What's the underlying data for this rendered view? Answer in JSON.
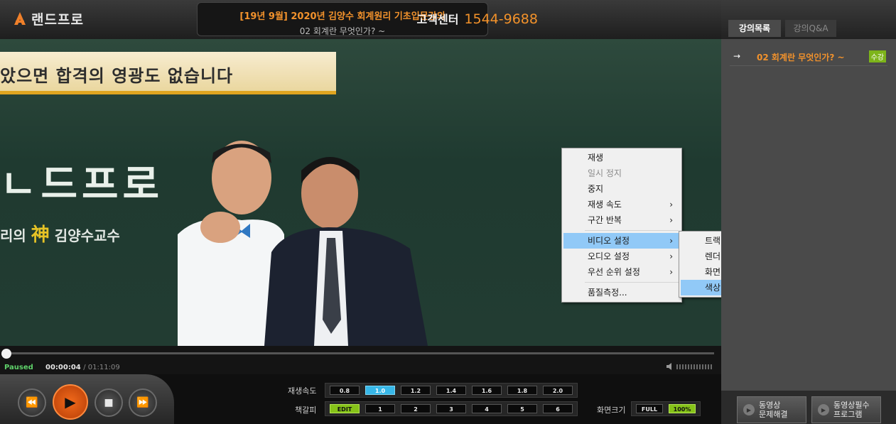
{
  "header": {
    "logo_text": "랜드프로",
    "lecture_title": "[19년 9월] 2020년 김양수 회계원리 기초입문강의",
    "lecture_subtitle": "02 회계란 무엇인가? ~",
    "customer_center_label": "고객센터",
    "customer_center_phone": "1544-9688"
  },
  "video": {
    "banner_text": "았으면 합격의 영광도 없습니다",
    "big_text": "ㄴ드프로",
    "sub_text_pre": "리의",
    "sub_text_highlight": "神",
    "sub_text_post": "김양수교수"
  },
  "context_menu": {
    "items": [
      {
        "label": "재생",
        "disabled": false,
        "submenu": false
      },
      {
        "label": "일시 정지",
        "disabled": true,
        "submenu": false
      },
      {
        "label": "중지",
        "disabled": false,
        "submenu": false
      },
      {
        "label": "재생 속도",
        "disabled": false,
        "submenu": true
      },
      {
        "label": "구간 반복",
        "disabled": false,
        "submenu": true
      },
      {
        "label": "비디오 설정",
        "disabled": false,
        "submenu": true,
        "highlighted": true
      },
      {
        "label": "오디오 설정",
        "disabled": false,
        "submenu": true
      },
      {
        "label": "우선 순위 설정",
        "disabled": false,
        "submenu": true
      },
      {
        "label": "품질측정...",
        "disabled": false,
        "submenu": false
      }
    ],
    "submenu_items": [
      {
        "label": "트랙",
        "submenu": true
      },
      {
        "label": "렌더러",
        "submenu": true
      },
      {
        "label": "화면 비율",
        "submenu": true
      },
      {
        "label": "색상 조절",
        "submenu": false,
        "highlighted": true
      }
    ],
    "arrow": "›"
  },
  "player": {
    "state": "Paused",
    "current_time": "00:00:04",
    "total_time": "/ 01:11:09",
    "progress_fraction": 0.001
  },
  "controls": {
    "icons": {
      "rewind": "⏪",
      "play": "▶",
      "stop": "■",
      "forward": "⏩"
    },
    "speed_label": "재생속도",
    "speeds": [
      "0.8",
      "1.0",
      "1.2",
      "1.4",
      "1.6",
      "1.8",
      "2.0"
    ],
    "speed_selected": "1.0",
    "bookmark_label": "책갈피",
    "bookmarks": [
      "EDIT",
      "1",
      "2",
      "3",
      "4",
      "5",
      "6"
    ],
    "screen_size_label": "화면크기",
    "screen_sizes": [
      "FULL",
      "100%"
    ],
    "screen_size_selected": "100%"
  },
  "side": {
    "tabs": [
      "강의목록",
      "강의Q&A"
    ],
    "lecture_arrow": "→",
    "lecture_item": "02 회계란 무엇인가? ~",
    "lecture_badge": "수강",
    "footer_buttons": [
      "동영상\n문제해결",
      "동영상필수\n프로그램"
    ]
  },
  "colors": {
    "accent_orange": "#f2922c",
    "speed_active": "#37b7e8",
    "green_active": "#86c319",
    "menu_highlight": "#91c9f7"
  }
}
